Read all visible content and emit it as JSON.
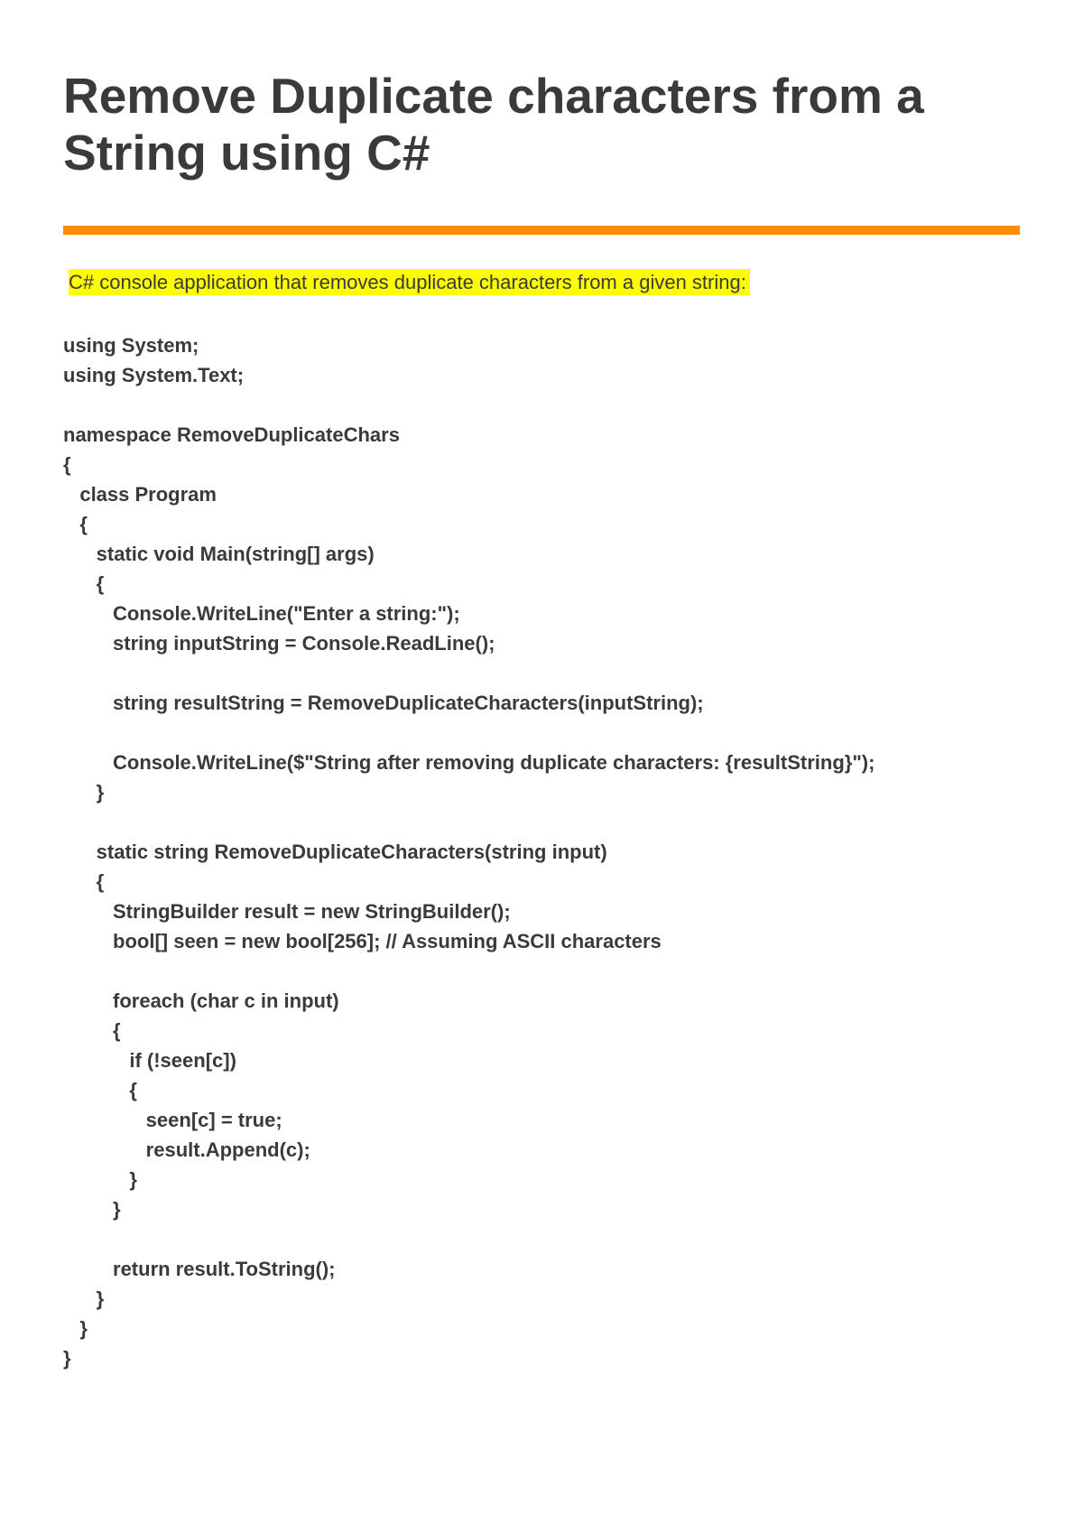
{
  "document": {
    "title": "Remove Duplicate characters from a String using C#",
    "intro": "C# console application that removes duplicate characters from a given string:",
    "code": "using System;\nusing System.Text;\n\nnamespace RemoveDuplicateChars\n{\n   class Program\n   {\n      static void Main(string[] args)\n      {\n         Console.WriteLine(\"Enter a string:\");\n         string inputString = Console.ReadLine();\n\n         string resultString = RemoveDuplicateCharacters(inputString);\n\n         Console.WriteLine($\"String after removing duplicate characters: {resultString}\");\n      }\n\n      static string RemoveDuplicateCharacters(string input)\n      {\n         StringBuilder result = new StringBuilder();\n         bool[] seen = new bool[256]; // Assuming ASCII characters\n\n         foreach (char c in input)\n         {\n            if (!seen[c])\n            {\n               seen[c] = true;\n               result.Append(c);\n            }\n         }\n\n         return result.ToString();\n      }\n   }\n}"
  }
}
